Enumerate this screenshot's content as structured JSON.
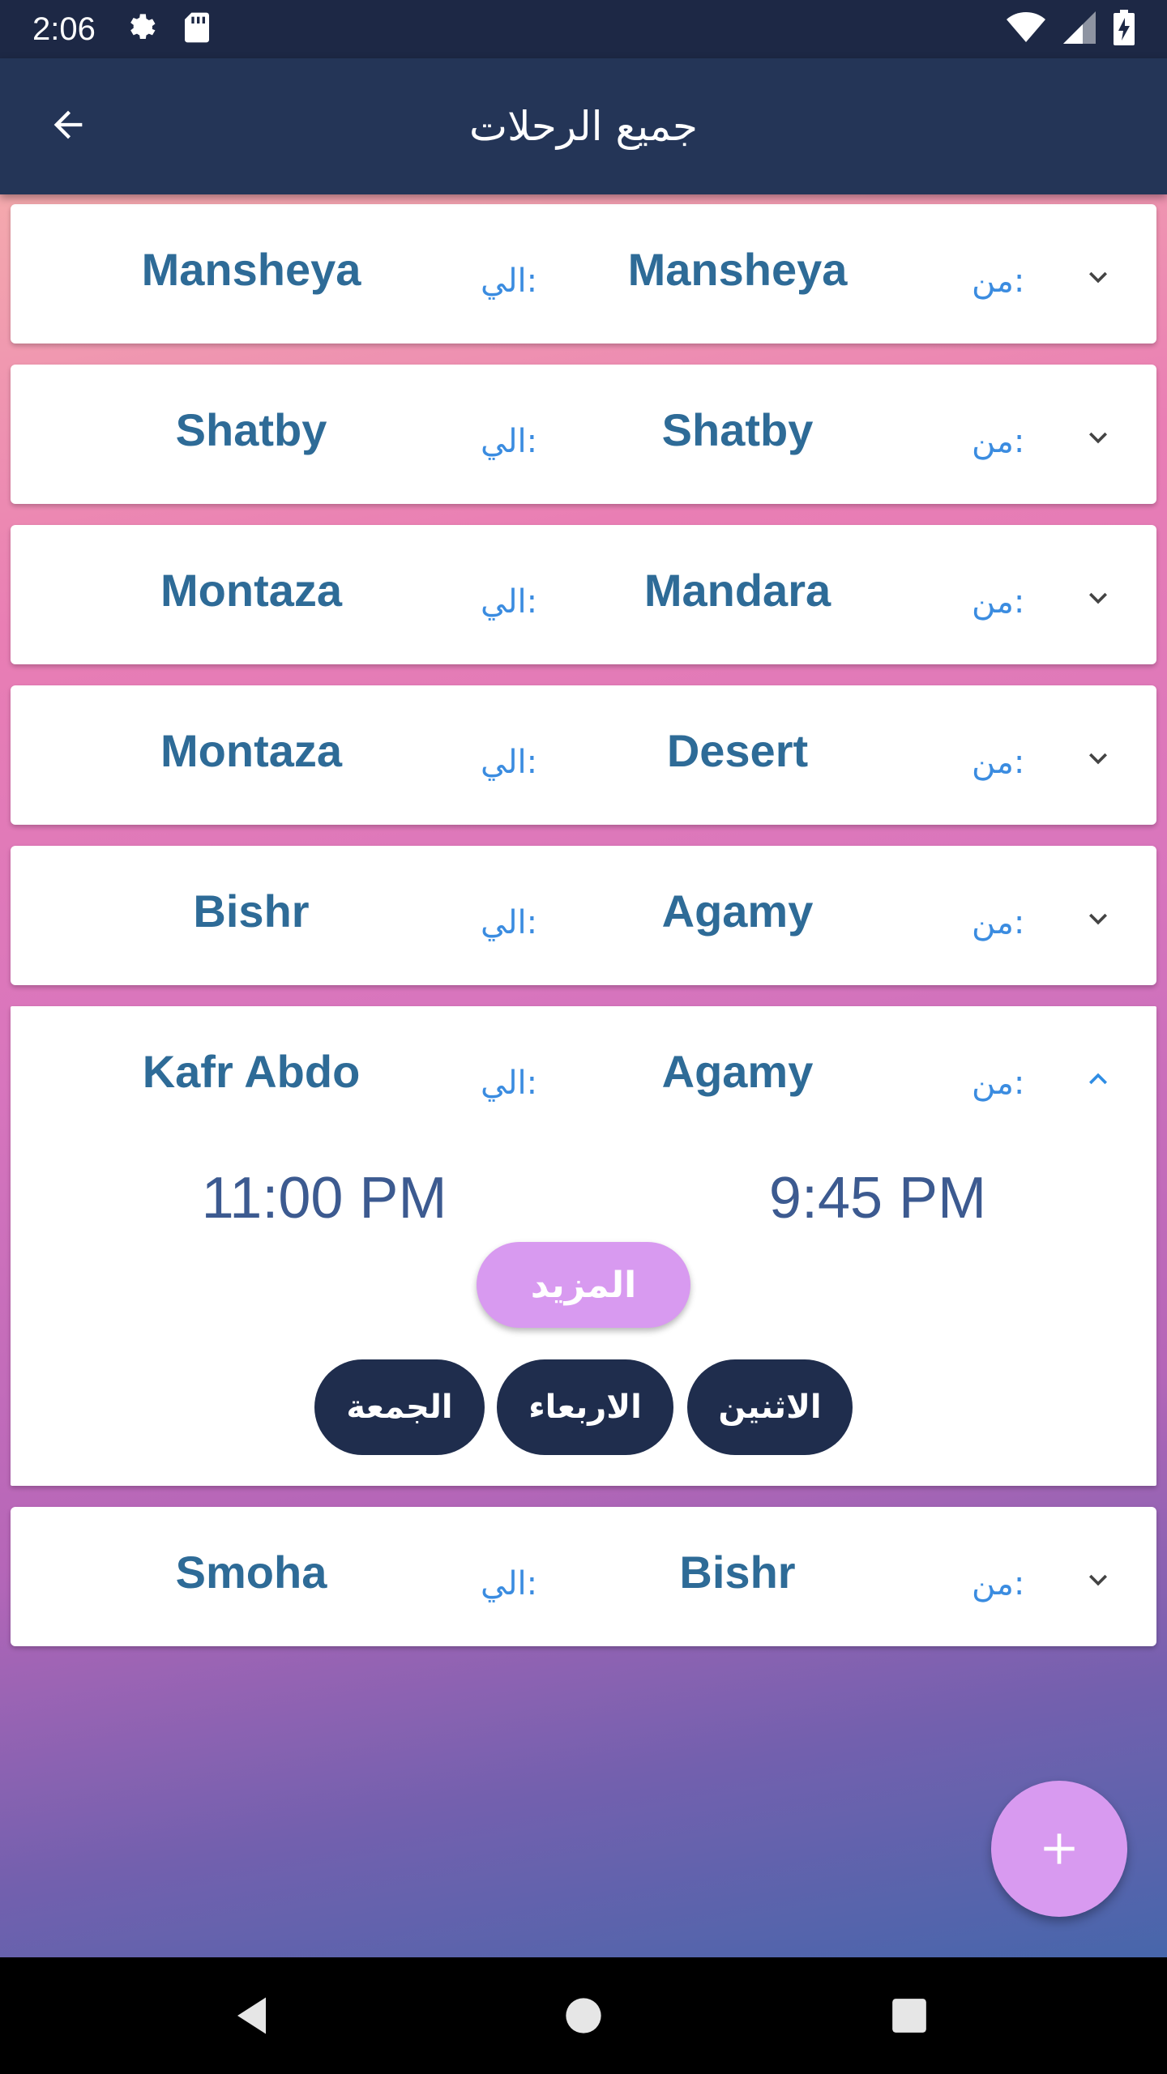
{
  "status_bar": {
    "time": "2:06",
    "icons": [
      "gear-icon",
      "sd-card-icon",
      "wifi-icon",
      "signal-icon",
      "battery-icon"
    ]
  },
  "app_bar": {
    "title": "جميع الرحلات",
    "back_icon": "arrow-back-icon"
  },
  "labels": {
    "from": "من:",
    "to": "الي:"
  },
  "trips": [
    {
      "from": "Mansheya",
      "to": "Mansheya",
      "expanded": false
    },
    {
      "from": "Shatby",
      "to": "Shatby",
      "expanded": false
    },
    {
      "from": "Mandara",
      "to": "Montaza",
      "expanded": false
    },
    {
      "from": "Desert",
      "to": "Montaza",
      "expanded": false
    },
    {
      "from": "Agamy",
      "to": "Bishr",
      "expanded": false
    },
    {
      "from": "Agamy",
      "to": "Kafr Abdo",
      "expanded": true,
      "start_time": "9:45 PM",
      "end_time": "11:00 PM",
      "more_label": "المزيد",
      "days": [
        "الاثنين",
        "الاربعاء",
        "الجمعة"
      ]
    },
    {
      "from": "Bishr",
      "to": "Smoha",
      "expanded": false
    }
  ],
  "fab": {
    "icon": "plus-icon"
  },
  "nav_bar": {
    "icons": [
      "back-triangle-icon",
      "home-circle-icon",
      "recents-square-icon"
    ]
  },
  "colors": {
    "app_bar": "#243557",
    "status_bar": "#1d2845",
    "place_text": "#2e6b97",
    "label_text": "#3b8ce0",
    "accent": "#d89af0",
    "chip": "#1f2d4d",
    "chevron_expanded": "#2f8de4"
  }
}
